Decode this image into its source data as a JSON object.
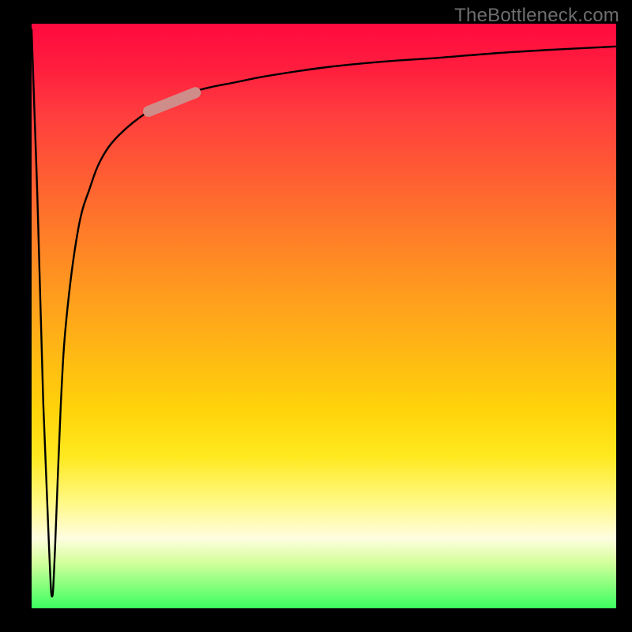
{
  "watermark": {
    "text": "TheBottleneck.com"
  },
  "chart_data": {
    "type": "line",
    "title": "",
    "xlabel": "",
    "ylabel": "",
    "xlim": [
      0,
      100
    ],
    "ylim": [
      0,
      100
    ],
    "grid": false,
    "legend": false,
    "series": [
      {
        "name": "bottleneck-curve",
        "note": "V-shaped curve: sharp drop near x≈3-4 to y≈0 (green), then asymptotically rising toward y≈96.",
        "x": [
          0,
          1,
          2,
          3,
          3.5,
          4,
          5,
          6,
          8,
          10,
          12,
          15,
          20,
          25,
          30,
          35,
          40,
          50,
          60,
          70,
          80,
          90,
          100
        ],
        "y": [
          99,
          70,
          35,
          10,
          2,
          10,
          35,
          50,
          65,
          72,
          77,
          81,
          85,
          87.5,
          89,
          90,
          91,
          92.5,
          93.5,
          94.2,
          95,
          95.6,
          96.1
        ]
      },
      {
        "name": "highlight-band",
        "note": "Short light-red thick segment along the rising part of the curve.",
        "x": [
          20,
          28
        ],
        "y": [
          85,
          88.2
        ]
      }
    ],
    "gradient_background": {
      "top_color": "#ff0a3f",
      "bottom_color": "#3bff5e"
    }
  }
}
